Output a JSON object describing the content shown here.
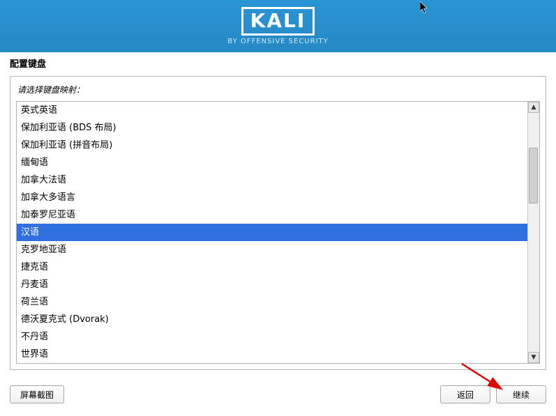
{
  "header": {
    "brand": "KALI",
    "subtitle": "BY OFFENSIVE SECURITY"
  },
  "page_title": "配置键盘",
  "prompt": "请选择键盘映射：",
  "keyboard_layouts": [
    {
      "label": "英式英语",
      "selected": false
    },
    {
      "label": "保加利亚语 (BDS 布局)",
      "selected": false
    },
    {
      "label": "保加利亚语 (拼音布局)",
      "selected": false
    },
    {
      "label": "缅甸语",
      "selected": false
    },
    {
      "label": "加拿大法语",
      "selected": false
    },
    {
      "label": "加拿大多语言",
      "selected": false
    },
    {
      "label": "加泰罗尼亚语",
      "selected": false
    },
    {
      "label": "汉语",
      "selected": true
    },
    {
      "label": "克罗地亚语",
      "selected": false
    },
    {
      "label": "捷克语",
      "selected": false
    },
    {
      "label": "丹麦语",
      "selected": false
    },
    {
      "label": "荷兰语",
      "selected": false
    },
    {
      "label": "德沃夏克式 (Dvorak)",
      "selected": false
    },
    {
      "label": "不丹语",
      "selected": false
    },
    {
      "label": "世界语",
      "selected": false
    }
  ],
  "buttons": {
    "screenshot": "屏幕截图",
    "back": "返回",
    "continue": "继续"
  }
}
